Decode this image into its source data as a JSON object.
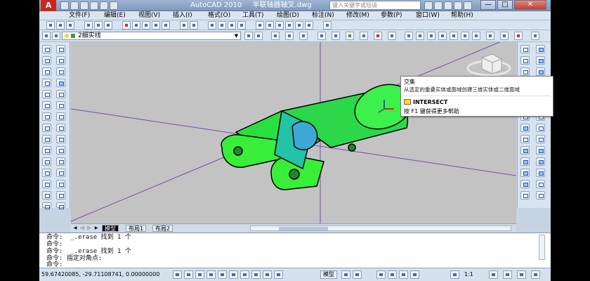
{
  "app": {
    "logo_text": "A",
    "title": "AutoCAD 2010",
    "file_name": "半联轴器轴叉.dwg",
    "search_placeholder": "键入关键字或短语",
    "window_buttons": [
      "—",
      "□",
      "✕"
    ]
  },
  "menu": [
    "文件(F)",
    "编辑(E)",
    "视图(V)",
    "插入(I)",
    "格式(O)",
    "工具(T)",
    "绘图(D)",
    "标注(N)",
    "修改(M)",
    "参数(P)",
    "窗口(W)",
    "帮助(H)"
  ],
  "layer_toolbar": {
    "current_layer": "2细实线"
  },
  "tooltip": {
    "title": "交集",
    "description": "从选定的重叠实体或面域创建三维实体或二维面域",
    "command": "INTERSECT",
    "help": "按 F1 键获得更多帮助"
  },
  "layout_tabs": [
    {
      "label": "模型",
      "active": true
    },
    {
      "label": "布局1",
      "active": false
    },
    {
      "label": "布局2",
      "active": false
    }
  ],
  "command_history": [
    "命令:  _.erase 找到 1 个",
    "命令:",
    "命令:  _.erase 找到 1 个",
    "命令: 指定对角点:"
  ],
  "command_prompt": "命令:",
  "status": {
    "coordinates": "59.67420085,  -29.71108741, 0.00000000",
    "model_label": "模型",
    "annotation_scale": "1:1"
  },
  "colors": {
    "viewport_bg": "#c3c3c3",
    "solid_fill": "#33ee33",
    "axis_lines": "#7a4aa8"
  }
}
